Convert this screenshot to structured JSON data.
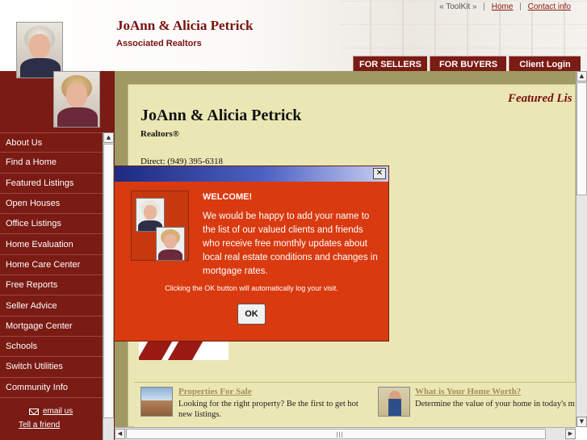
{
  "header": {
    "toplinks": {
      "toolkit": "« ToolKit »",
      "home": "Home",
      "contact": "Contact info",
      "separator": "|"
    },
    "site_title": "JoAnn & Alicia Petrick",
    "site_subtitle": "Associated Realtors",
    "tabs": [
      "FOR SELLERS",
      "FOR BUYERS",
      "Client Login"
    ]
  },
  "sidebar": {
    "items": [
      "About Us",
      "Find a Home",
      "Featured Listings",
      "Open Houses",
      "Office Listings",
      "Home Evaluation",
      "Home Care Center",
      "Free Reports",
      "Seller Advice",
      "Mortgage Center",
      "Schools",
      "Switch Utilities",
      "Community Info"
    ],
    "email_label": "email us",
    "friend_label": "Tell a friend"
  },
  "main": {
    "featured_heading": "Featured Lis",
    "title": "JoAnn & Alicia Petrick",
    "subtitle": "Realtors®",
    "direct": "Direct: (949) 395-6318",
    "promos": [
      {
        "title": "Properties For Sale",
        "text": "Looking for the right property? Be the first to get hot new listings."
      },
      {
        "title": "What is Your Home Worth?",
        "text": "Determine the value of your home in today's m"
      }
    ]
  },
  "modal": {
    "close_label": "✕",
    "heading": "WELCOME!",
    "body": "We would be happy to add your name to the list of our valued clients and friends who receive free monthly updates about local real estate conditions and changes in mortgage rates.",
    "note": "Clicking the OK button will automatically log your visit.",
    "ok_label": "OK"
  },
  "colors": {
    "brand_maroon": "#7a1b14",
    "content_olive": "#9f9a63",
    "content_cream": "#ebe7b4",
    "modal_red": "#d93a10"
  },
  "icons": [
    "envelope-icon",
    "scroll-up-arrow-icon",
    "scroll-down-arrow-icon",
    "scroll-left-arrow-icon",
    "scroll-right-arrow-icon",
    "close-icon"
  ]
}
